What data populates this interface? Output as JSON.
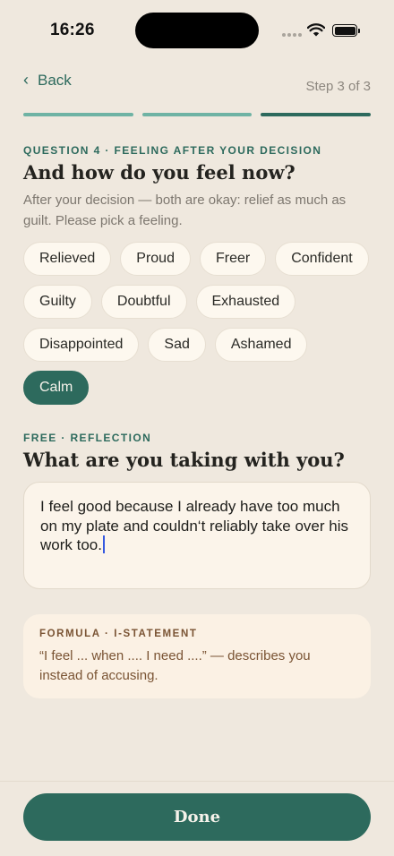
{
  "status_bar": {
    "time": "16:26"
  },
  "nav": {
    "back_label": "Back",
    "step_label": "Step 3 of 3"
  },
  "question": {
    "eyebrow": "QUESTION 4 · FEELING AFTER YOUR DECISION",
    "title": "And how do you feel now?",
    "subtitle": "After your decision — both are okay: relief as much as guilt. Please pick a feeling."
  },
  "feelings": [
    {
      "label": "Relieved",
      "selected": false
    },
    {
      "label": "Proud",
      "selected": false
    },
    {
      "label": "Freer",
      "selected": false
    },
    {
      "label": "Confident",
      "selected": false
    },
    {
      "label": "Guilty",
      "selected": false
    },
    {
      "label": "Doubtful",
      "selected": false
    },
    {
      "label": "Exhausted",
      "selected": false
    },
    {
      "label": "Disappointed",
      "selected": false
    },
    {
      "label": "Sad",
      "selected": false
    },
    {
      "label": "Ashamed",
      "selected": false
    },
    {
      "label": "Calm",
      "selected": true
    }
  ],
  "reflection": {
    "eyebrow": "FREE · REFLECTION",
    "title": "What are you taking with you?",
    "value": "I feel good because I already have too much on my plate and couldn‘t reliably take over his work too."
  },
  "formula": {
    "label": "FORMULA · I-STATEMENT",
    "text": "“I feel ... when .... I need ....” — describes you instead of accusing."
  },
  "footer": {
    "done_label": "Done"
  },
  "colors": {
    "accent": "#2D6A5D",
    "progress_done": "#6FB3A4",
    "background": "#EFE8DE",
    "formula_text": "#7A5434"
  }
}
